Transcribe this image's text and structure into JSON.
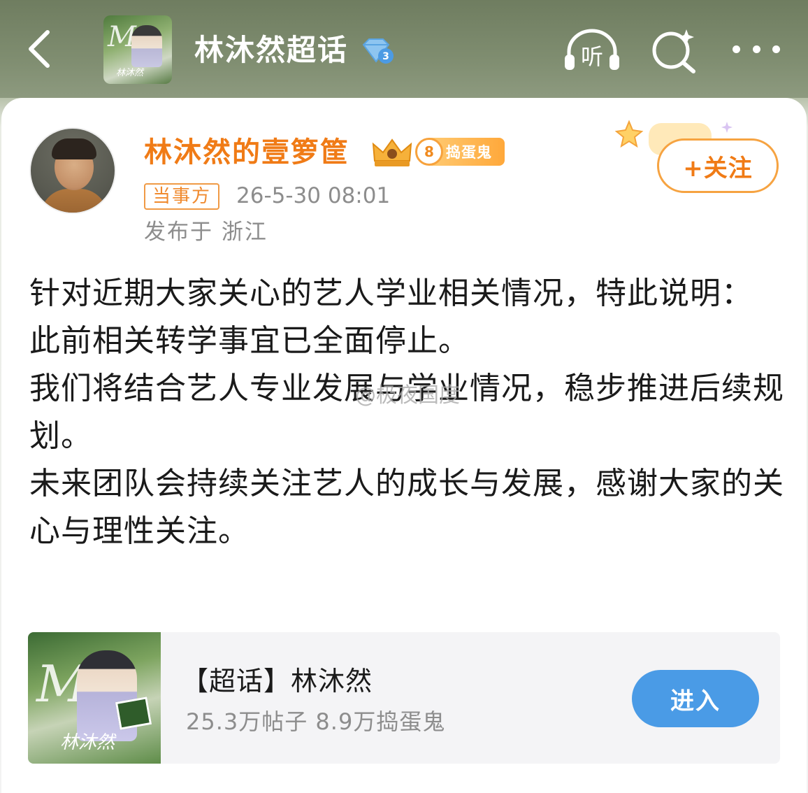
{
  "header": {
    "title": "林沐然超话",
    "level_badge": "3",
    "topic_thumb_caption": "林沐然",
    "listen_label": "听",
    "icons": [
      "back-icon",
      "headphones-icon",
      "search-sparkle-icon",
      "more-icon"
    ]
  },
  "post": {
    "author": {
      "name": "林沐然的壹箩筐",
      "level": "8",
      "level_label": "捣蛋鬼",
      "party_tag": "当事方"
    },
    "timestamp": "26-5-30 08:01",
    "location": "发布于 浙江",
    "follow_label": "+关注",
    "body": [
      "针对近期大家关心的艺人学业相关情况，特此说明：",
      "此前相关转学事宜已全面停止。",
      "我们将结合艺人专业发展与学业情况，稳步推进后续规划。",
      "未来团队会持续关注艺人的成长与发展，感谢大家的关心与理性关注。"
    ],
    "watermark": "@极夜国度"
  },
  "topic_card": {
    "name": "【超话】林沐然",
    "stats": "25.3万帖子 8.9万捣蛋鬼",
    "cover_caption": "林沐然",
    "enter_label": "进入"
  },
  "colors": {
    "accent_orange": "#f07b16",
    "enter_blue": "#4a9be6",
    "header_green": "#7f8d70"
  }
}
